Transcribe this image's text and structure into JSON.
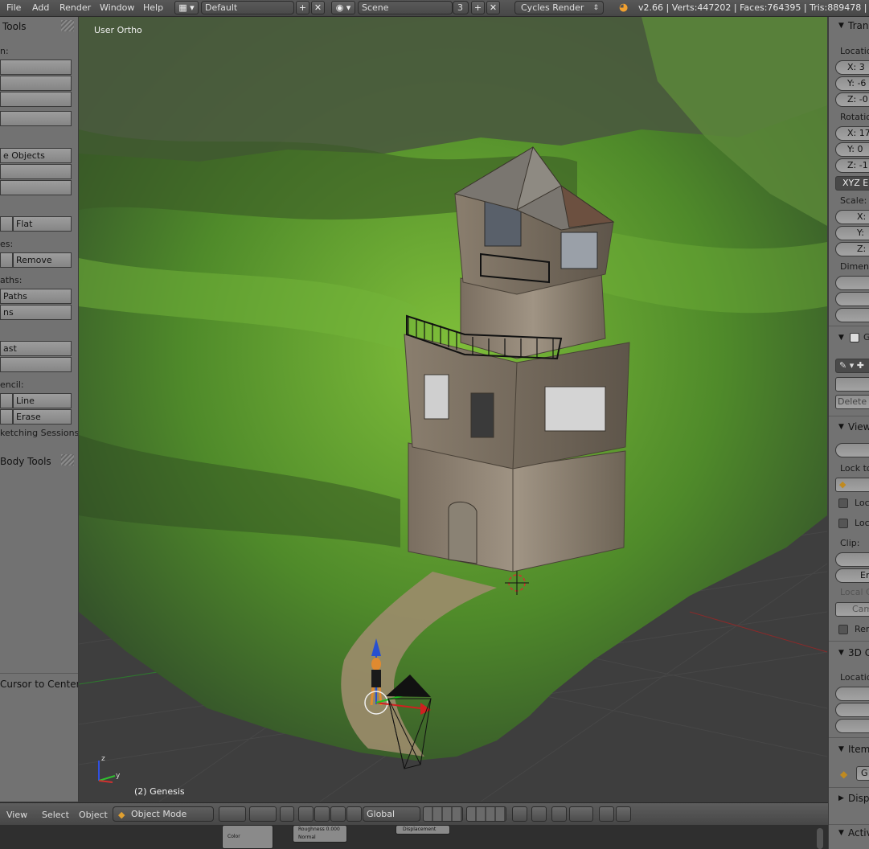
{
  "topbar": {
    "menus": [
      "File",
      "Add",
      "Render",
      "Window",
      "Help"
    ],
    "screen_layout": "Default",
    "scene": "Scene",
    "scene_users": "3",
    "render_engine": "Cycles Render",
    "stats": "v2.66 | Verts:447202 | Faces:764395 | Tris:889478 | Ob"
  },
  "left_panel": {
    "header": "Tools",
    "labels": [
      "n:",
      "es:",
      "aths:",
      "encil:"
    ],
    "buttons": [
      "e Objects",
      "Flat",
      "Remove",
      "Paths",
      "ns",
      "ast",
      "Line",
      "Erase"
    ],
    "sketching": "ketching Sessions",
    "rigid_body": "Body Tools",
    "cursor_to_center": "Cursor to Center"
  },
  "right_panel": {
    "transform_header": "Trans",
    "location_label": "Locatio",
    "loc": [
      "X: 3",
      "Y: -6",
      "Z: -0"
    ],
    "rotation_label": "Rotatio",
    "rot": [
      "X: 17",
      "Y: 0",
      "Z: -1"
    ],
    "euler": "XYZ Eu",
    "scale_label": "Scale:",
    "scale": [
      "X:",
      "Y:",
      "Z:"
    ],
    "dimensions_label": "Dimens",
    "grease_header": "G",
    "delete_label": "Delete F",
    "view_header": "View",
    "lock_label": "Lock to",
    "lock_items": [
      "Loc",
      "Loc"
    ],
    "clip_label": "Clip:",
    "clip_end": "En",
    "local_camera": "Local C",
    "camera_field": "Cam",
    "render_border": "Ren",
    "cursor_header": "3D C",
    "cursor_location": "Locatio",
    "item_header": "Item",
    "item_name": "G",
    "display_header": "Disp",
    "active_header": "Activ"
  },
  "viewport": {
    "view_label": "User Ortho",
    "object_label": "(2) Genesis"
  },
  "bottombar": {
    "menus": [
      "View",
      "Select",
      "Object"
    ],
    "mode": "Object Mode",
    "orientation": "Global"
  },
  "node_editor": {
    "roughness": "Roughness 0.000",
    "normal": "Normal",
    "displacement": "Displacement",
    "color": "Color"
  },
  "colors": {
    "panel_bg": "#727272",
    "header_bg": "#4f4f4f",
    "grass": "#4a7a2a",
    "tower_wood": "#8c8070"
  }
}
